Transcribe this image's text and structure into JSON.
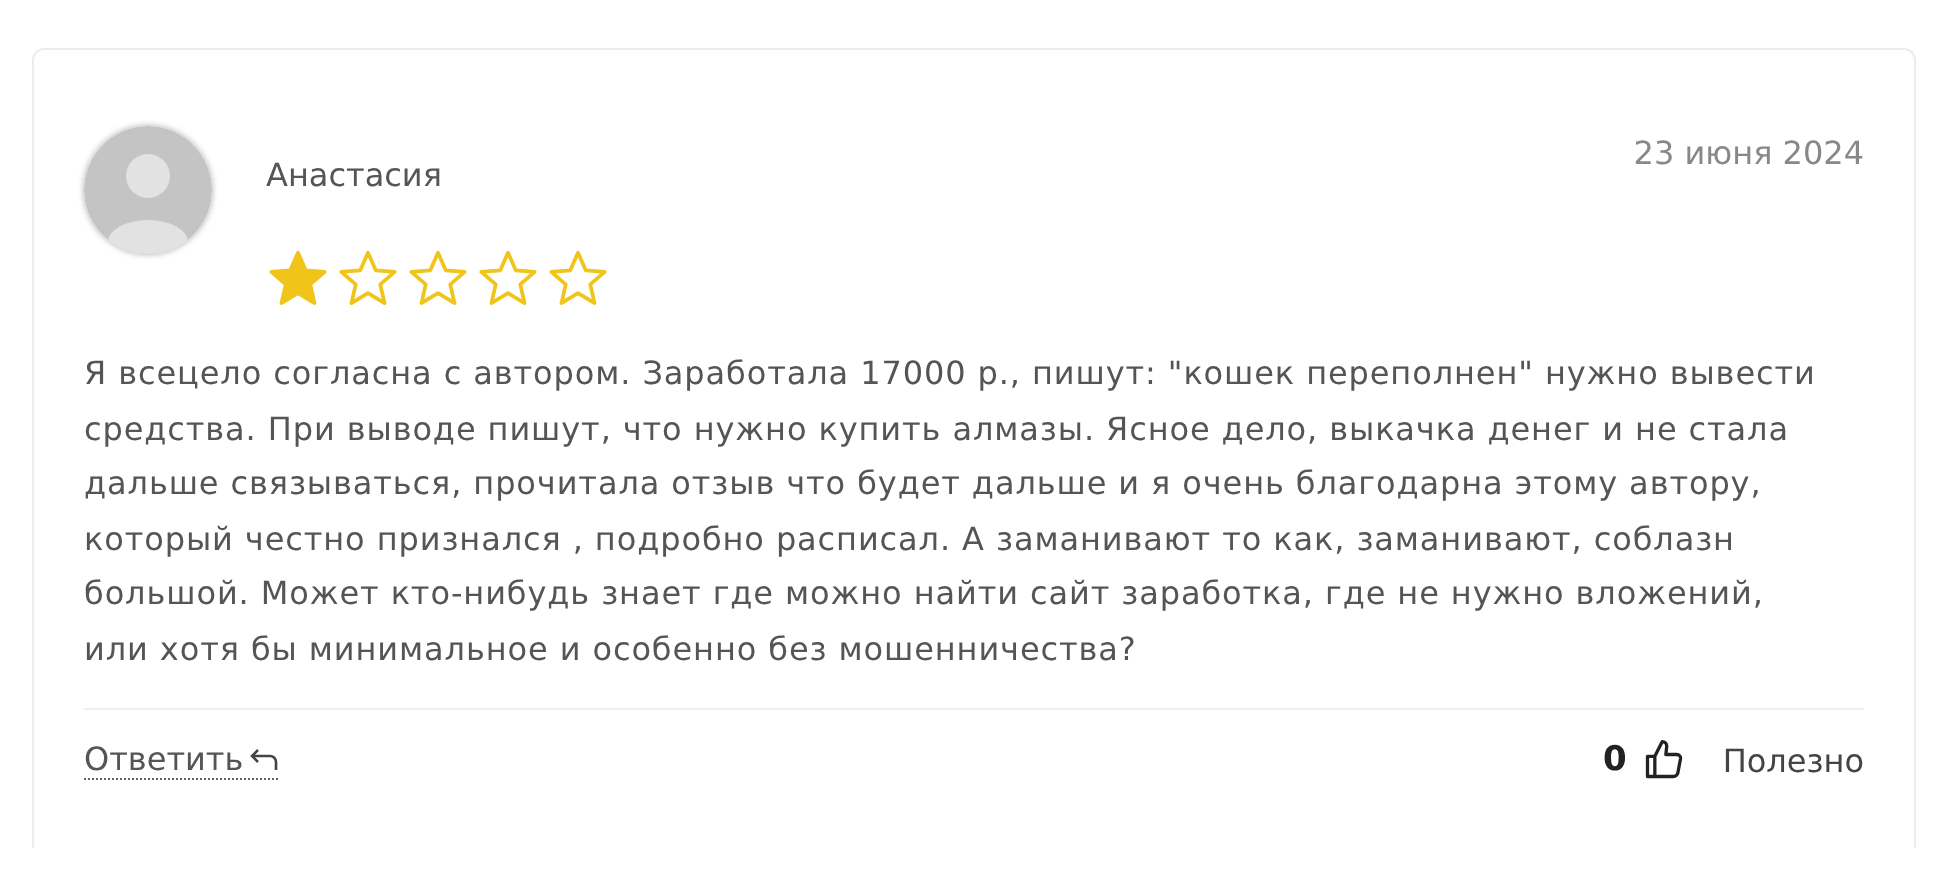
{
  "review": {
    "author": "Анастасия",
    "date": "23 июня 2024",
    "stars": 1,
    "text": "Я всецело согласна с автором. Заработала 17000 р., пишут: \"кошек переполнен\" нужно вывести средства. При выводе пишут, что нужно купить алмазы. Ясное дело, выкачка денег и не стала дальше связываться, прочитала отзыв что будет дальше и я очень благодарна этому автору, который честно признался , подробно расписал. А заманивают то как, заманивают, соблазн большой. Может кто-нибудь знает где можно найти сайт заработка, где не нужно вложений, или хотя бы минимальное и особенно без мошенничества?",
    "reply": "Ответить",
    "likes": "0",
    "useful": "Полезно"
  }
}
